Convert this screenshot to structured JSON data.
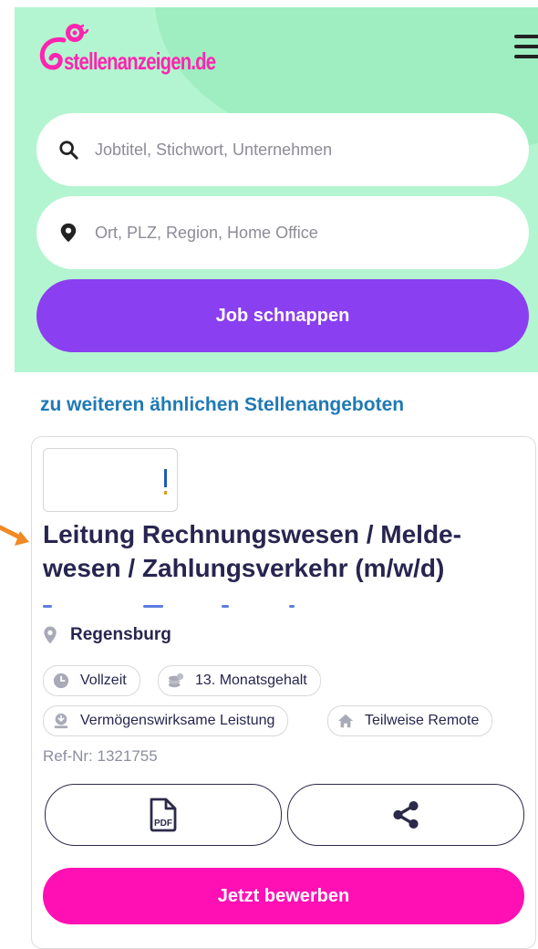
{
  "header": {
    "logo_text": "stellenanzeigen.de",
    "menu_icon": "hamburger-menu-icon"
  },
  "search": {
    "keyword_placeholder": "Jobtitel, Stichwort, Unternehmen",
    "keyword_value": "",
    "location_placeholder": "Ort, PLZ, Region, Home Office",
    "location_value": "",
    "submit_label": "Job schnappen"
  },
  "similar_link": "zu weiteren ähnlichen Stellenangeboten",
  "job": {
    "title": "Leitung Rechnungswesen / Melde-wesen / Zahlungsverkehr (m/w/d)",
    "location": "Regensburg",
    "tags": [
      {
        "label": "Vollzeit",
        "icon": "clock-icon"
      },
      {
        "label": "13. Monatsgehalt",
        "icon": "coins-icon"
      },
      {
        "label": "Vermögenswirksame Leistung",
        "icon": "savings-icon"
      },
      {
        "label": "Teilweise Remote",
        "icon": "home-icon"
      }
    ],
    "ref": "Ref-Nr: 1321755",
    "pdf_icon_label": "PDF",
    "apply_label": "Jetzt bewerben"
  },
  "colors": {
    "hero_bg": "#b3f5d0",
    "brand_pink": "#ff24b0",
    "search_button": "#8a3ff0",
    "apply_button": "#ff10b4",
    "link": "#1f79b5",
    "annotation_arrow": "#f08a24"
  }
}
